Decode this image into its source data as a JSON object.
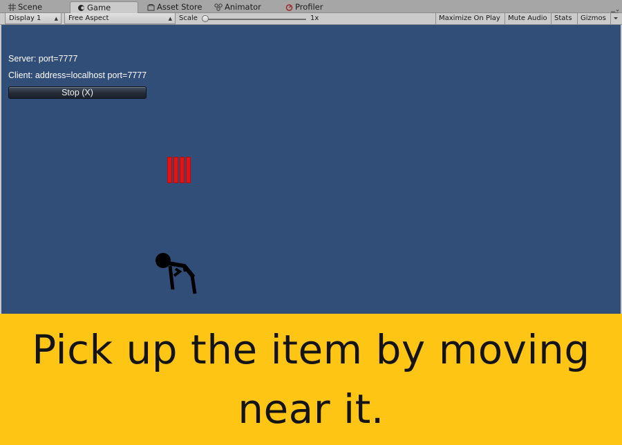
{
  "tabs": [
    {
      "label": "Scene",
      "icon": "grid-icon"
    },
    {
      "label": "Game",
      "icon": "game-controller-icon",
      "active": true
    },
    {
      "label": "Asset Store",
      "icon": "store-icon"
    },
    {
      "label": "Animator",
      "icon": "animator-icon"
    },
    {
      "label": "Profiler",
      "icon": "profiler-icon"
    }
  ],
  "toolbar": {
    "display": "Display 1",
    "aspect": "Free Aspect",
    "scale_label": "Scale",
    "scale_value": "1x",
    "maximize": "Maximize On Play",
    "mute": "Mute Audio",
    "stats": "Stats",
    "gizmos": "Gizmos"
  },
  "hud": {
    "server": "Server: port=7777",
    "client": "Client: address=localhost port=7777",
    "stop_button": "Stop (X)"
  },
  "colors": {
    "viewport": "#314e79",
    "pickup": "#e01414",
    "caption_bg": "#fec515"
  },
  "caption": "Pick up the item by moving near it."
}
